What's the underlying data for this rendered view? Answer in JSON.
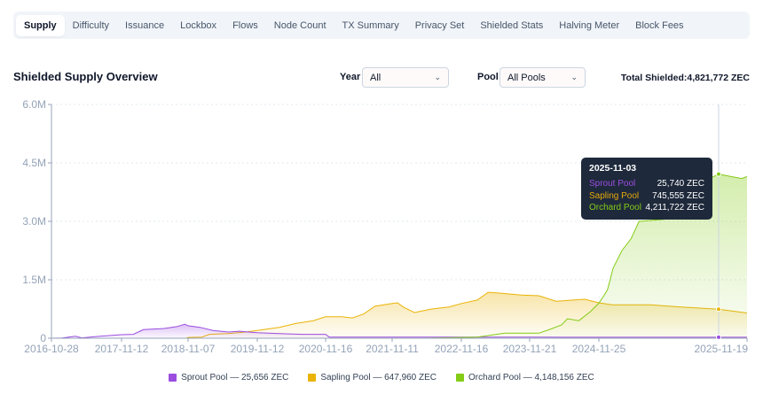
{
  "tabs": [
    {
      "label": "Supply",
      "active": true
    },
    {
      "label": "Difficulty"
    },
    {
      "label": "Issuance"
    },
    {
      "label": "Lockbox"
    },
    {
      "label": "Flows"
    },
    {
      "label": "Node Count"
    },
    {
      "label": "TX Summary"
    },
    {
      "label": "Privacy Set"
    },
    {
      "label": "Shielded Stats"
    },
    {
      "label": "Halving Meter"
    },
    {
      "label": "Block Fees"
    }
  ],
  "header": {
    "title": "Shielded Supply Overview",
    "year_label": "Year",
    "year_value": "All",
    "pool_label": "Pool",
    "pool_value": "All Pools",
    "total": "Total Shielded:4,821,772 ZEC"
  },
  "tooltip": {
    "date": "2025-11-03",
    "rows": [
      {
        "name": "Sprout Pool",
        "value": "25,740 ZEC",
        "color": "#9b4de0"
      },
      {
        "name": "Sapling Pool",
        "value": "745,555 ZEC",
        "color": "#e5a90a"
      },
      {
        "name": "Orchard Pool",
        "value": "4,211,722 ZEC",
        "color": "#84cc16"
      }
    ]
  },
  "legend": [
    {
      "label": "Sprout Pool — 25,656 ZEC",
      "color": "#9b4de0"
    },
    {
      "label": "Sapling Pool — 647,960 ZEC",
      "color": "#eab308"
    },
    {
      "label": "Orchard Pool — 4,148,156 ZEC",
      "color": "#84cc16"
    }
  ],
  "chart_data": {
    "type": "area",
    "ylim": [
      0,
      6000000
    ],
    "yticks": [
      {
        "v": 0,
        "label": "0"
      },
      {
        "v": 1500000,
        "label": "1.5M"
      },
      {
        "v": 3000000,
        "label": "3.0M"
      },
      {
        "v": 4500000,
        "label": "4.5M"
      },
      {
        "v": 6000000,
        "label": "6.0M"
      }
    ],
    "xticks": [
      "2016-10-28",
      "2017-11-12",
      "2018-11-07",
      "2019-11-12",
      "2020-11-16",
      "2021-11-11",
      "2022-11-16",
      "2023-11-21",
      "2024-11-25",
      "2025-11-19"
    ],
    "grid": true,
    "legend": "bottom",
    "series": [
      {
        "name": "Sprout Pool",
        "color": "#9b4de0",
        "points": [
          [
            "2016-10-28",
            0
          ],
          [
            "2016-12-25",
            5000
          ],
          [
            "2017-03-07",
            50000
          ],
          [
            "2017-04-10",
            10000
          ],
          [
            "2017-06-20",
            40000
          ],
          [
            "2017-11-12",
            90000
          ],
          [
            "2018-01-15",
            100000
          ],
          [
            "2018-03-10",
            220000
          ],
          [
            "2018-07-01",
            250000
          ],
          [
            "2018-09-10",
            300000
          ],
          [
            "2018-10-20",
            360000
          ],
          [
            "2018-11-07",
            320000
          ],
          [
            "2019-01-10",
            280000
          ],
          [
            "2019-03-20",
            200000
          ],
          [
            "2019-06-10",
            160000
          ],
          [
            "2019-08-10",
            180000
          ],
          [
            "2019-11-12",
            140000
          ],
          [
            "2020-03-10",
            120000
          ],
          [
            "2020-07-10",
            100000
          ],
          [
            "2020-11-16",
            100000
          ],
          [
            "2020-12-05",
            30000
          ],
          [
            "2021-11-11",
            28000
          ],
          [
            "2023-11-21",
            27000
          ],
          [
            "2025-11-03",
            25740
          ],
          [
            "2025-11-19",
            25656
          ]
        ]
      },
      {
        "name": "Sapling Pool",
        "color": "#eab308",
        "points": [
          [
            "2018-10-28",
            0
          ],
          [
            "2018-11-07",
            20000
          ],
          [
            "2019-01-20",
            30000
          ],
          [
            "2019-03-01",
            100000
          ],
          [
            "2019-06-10",
            120000
          ],
          [
            "2019-09-10",
            160000
          ],
          [
            "2019-11-12",
            200000
          ],
          [
            "2020-03-10",
            280000
          ],
          [
            "2020-06-10",
            380000
          ],
          [
            "2020-09-10",
            450000
          ],
          [
            "2020-11-16",
            550000
          ],
          [
            "2021-02-10",
            550000
          ],
          [
            "2021-04-10",
            520000
          ],
          [
            "2021-06-10",
            620000
          ],
          [
            "2021-08-10",
            820000
          ],
          [
            "2021-11-11",
            890000
          ],
          [
            "2021-12-10",
            910000
          ],
          [
            "2022-01-10",
            800000
          ],
          [
            "2022-03-10",
            660000
          ],
          [
            "2022-06-10",
            750000
          ],
          [
            "2022-09-10",
            800000
          ],
          [
            "2022-11-16",
            890000
          ],
          [
            "2023-02-10",
            980000
          ],
          [
            "2023-04-10",
            1180000
          ],
          [
            "2023-06-10",
            1160000
          ],
          [
            "2023-10-10",
            1110000
          ],
          [
            "2024-01-10",
            1090000
          ],
          [
            "2024-04-10",
            950000
          ],
          [
            "2024-09-10",
            1000000
          ],
          [
            "2024-11-25",
            910000
          ],
          [
            "2025-01-03",
            860000
          ],
          [
            "2025-04-20",
            860000
          ],
          [
            "2025-07-20",
            800000
          ],
          [
            "2025-11-03",
            745555
          ],
          [
            "2025-11-19",
            647960
          ]
        ]
      },
      {
        "name": "Orchard Pool",
        "color": "#84cc16",
        "points": [
          [
            "2016-10-28",
            0
          ],
          [
            "2022-05-01",
            0
          ],
          [
            "2023-02-10",
            30000
          ],
          [
            "2023-07-10",
            130000
          ],
          [
            "2024-01-10",
            130000
          ],
          [
            "2024-03-10",
            230000
          ],
          [
            "2024-05-10",
            340000
          ],
          [
            "2024-06-10",
            500000
          ],
          [
            "2024-08-10",
            450000
          ],
          [
            "2024-10-10",
            680000
          ],
          [
            "2024-11-25",
            900000
          ],
          [
            "2024-12-10",
            1100000
          ],
          [
            "2024-12-20",
            1250000
          ],
          [
            "2025-01-05",
            1800000
          ],
          [
            "2025-01-30",
            2250000
          ],
          [
            "2025-02-25",
            2550000
          ],
          [
            "2025-03-20",
            3000000
          ],
          [
            "2025-05-30",
            3050000
          ],
          [
            "2025-06-20",
            3300000
          ],
          [
            "2025-08-01",
            3700000
          ],
          [
            "2025-09-15",
            4000000
          ],
          [
            "2025-11-03",
            4211722
          ],
          [
            "2025-11-10",
            4150000
          ],
          [
            "2025-11-16",
            4100000
          ],
          [
            "2025-11-19",
            4148156
          ]
        ]
      }
    ],
    "highlight_date": "2025-11-03"
  }
}
